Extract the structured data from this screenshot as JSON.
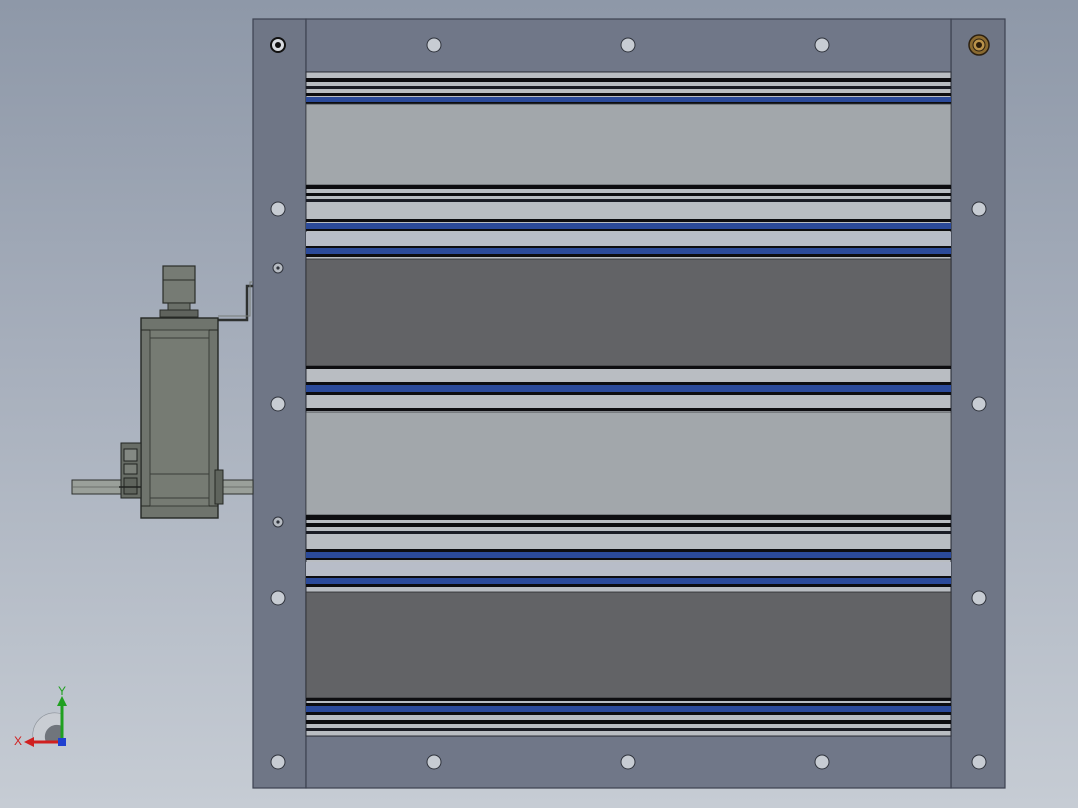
{
  "viewport": {
    "background_top": "#8e98a8",
    "background_bottom": "#c6ccd4"
  },
  "model": {
    "frame_color": "#6f7686",
    "frame_edge_color": "#3d4250",
    "blade_light_color": "#a2a7ab",
    "blade_dark_color": "#626366",
    "seal_blue_color": "#2b4a9a",
    "seal_black_color": "#0d0d10",
    "actuator_color": "#6f746d",
    "blades": [
      {
        "shade": "light"
      },
      {
        "shade": "dark"
      },
      {
        "shade": "light"
      },
      {
        "shade": "dark"
      }
    ]
  },
  "triad": {
    "x_label": "X",
    "y_label": "Y",
    "x_color": "#d02020",
    "y_color": "#20a020",
    "z_color": "#2040d0",
    "icon": "coordinate-triad-icon"
  }
}
